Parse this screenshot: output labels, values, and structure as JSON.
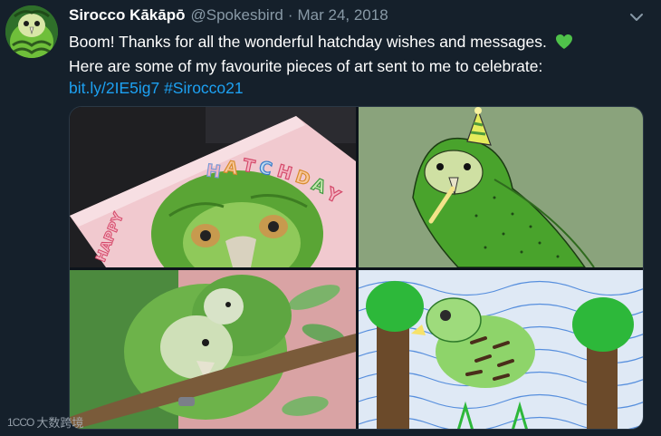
{
  "tweet": {
    "display_name": "Sirocco Kākāpō",
    "handle": "@Spokesbird",
    "separator": "·",
    "date": "Mar 24, 2018",
    "text_line1": "Boom! Thanks for all the wonderful hatchday wishes and messages.",
    "text_line2": "Here are some of my favourite pieces of art sent to me to celebrate:",
    "link": "bit.ly/2IE5ig7",
    "hashtag": "#Sirocco21",
    "heart_emoji": "green-heart-icon",
    "caret_icon": "chevron-down-icon"
  },
  "media": {
    "painting1_text": "HAPPY HATCHDAY"
  },
  "watermark": {
    "logo": "1CCO",
    "text": "大数跨境"
  },
  "colors": {
    "background": "#15202b",
    "secondary_text": "#8899a6",
    "link": "#1da1f2",
    "heart": "#4fc24a"
  }
}
